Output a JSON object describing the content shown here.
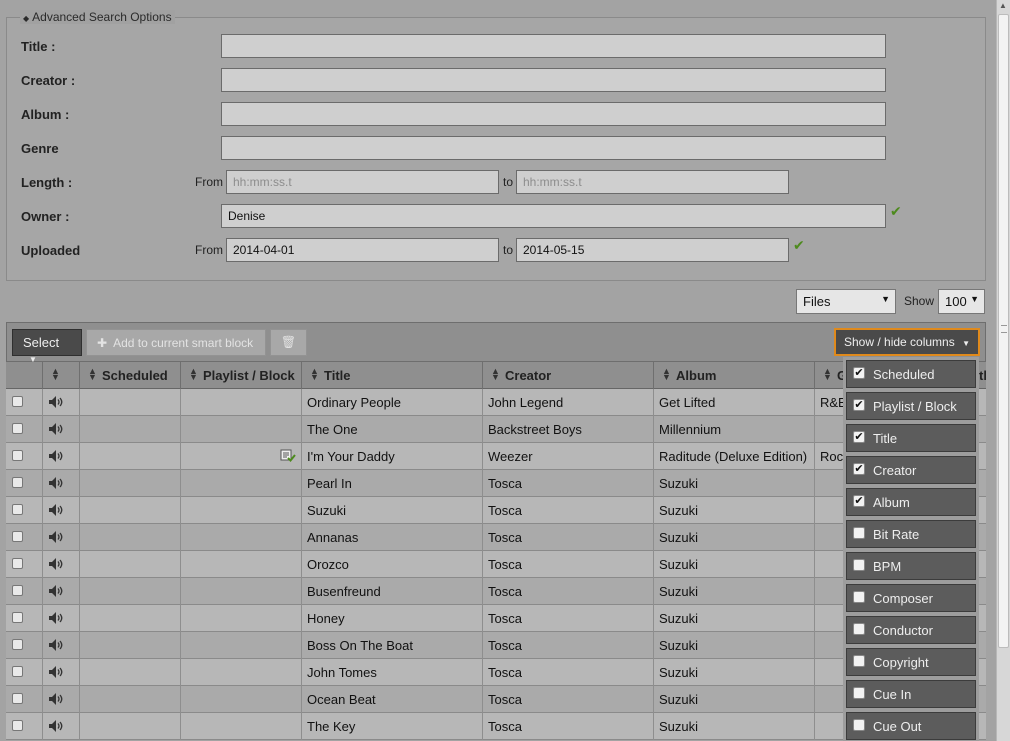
{
  "advanced_search": {
    "legend": "Advanced Search Options",
    "title_label": "Title :",
    "creator_label": "Creator :",
    "album_label": "Album :",
    "genre_label": "Genre",
    "length_label": "Length :",
    "owner_label": "Owner :",
    "uploaded_label": "Uploaded",
    "from_label": "From",
    "to_label": "to",
    "length_from_placeholder": "hh:mm:ss.t",
    "length_to_placeholder": "hh:mm:ss.t",
    "owner_value": "Denise",
    "uploaded_from": "2014-04-01",
    "uploaded_to": "2014-05-15"
  },
  "filter": {
    "type_value": "Files",
    "show_label": "Show",
    "show_value": "100"
  },
  "toolbar": {
    "select_label": "Select",
    "add_label": "Add to current smart block",
    "show_hide_label": "Show / hide columns"
  },
  "columns": [
    "Scheduled",
    "Playlist / Block",
    "Title",
    "Creator",
    "Album",
    "G",
    "th"
  ],
  "rows": [
    {
      "title": "Ordinary People",
      "creator": "John Legend",
      "album": "Get Lifted",
      "genre": "R&B"
    },
    {
      "title": "The One",
      "creator": "Backstreet Boys",
      "album": "Millennium",
      "genre": ""
    },
    {
      "title": "I'm Your Daddy",
      "creator": "Weezer",
      "album": "Raditude (Deluxe Edition)",
      "genre": "Roc"
    },
    {
      "title": "Pearl In",
      "creator": "Tosca",
      "album": "Suzuki",
      "genre": ""
    },
    {
      "title": "Suzuki",
      "creator": "Tosca",
      "album": "Suzuki",
      "genre": ""
    },
    {
      "title": "Annanas",
      "creator": "Tosca",
      "album": "Suzuki",
      "genre": ""
    },
    {
      "title": "Orozco",
      "creator": "Tosca",
      "album": "Suzuki",
      "genre": ""
    },
    {
      "title": "Busenfreund",
      "creator": "Tosca",
      "album": "Suzuki",
      "genre": ""
    },
    {
      "title": "Honey",
      "creator": "Tosca",
      "album": "Suzuki",
      "genre": ""
    },
    {
      "title": "Boss On The Boat",
      "creator": "Tosca",
      "album": "Suzuki",
      "genre": ""
    },
    {
      "title": "John Tomes",
      "creator": "Tosca",
      "album": "Suzuki",
      "genre": ""
    },
    {
      "title": "Ocean Beat",
      "creator": "Tosca",
      "album": "Suzuki",
      "genre": ""
    },
    {
      "title": "The Key",
      "creator": "Tosca",
      "album": "Suzuki",
      "genre": ""
    }
  ],
  "column_menu": [
    {
      "label": "Scheduled",
      "checked": true
    },
    {
      "label": "Playlist / Block",
      "checked": true
    },
    {
      "label": "Title",
      "checked": true
    },
    {
      "label": "Creator",
      "checked": true
    },
    {
      "label": "Album",
      "checked": true
    },
    {
      "label": "Bit Rate",
      "checked": false
    },
    {
      "label": "BPM",
      "checked": false
    },
    {
      "label": "Composer",
      "checked": false
    },
    {
      "label": "Conductor",
      "checked": false
    },
    {
      "label": "Copyright",
      "checked": false
    },
    {
      "label": "Cue In",
      "checked": false
    },
    {
      "label": "Cue Out",
      "checked": false
    }
  ],
  "colors": {
    "accent": "#e08a1c",
    "check": "#4d8a1d"
  }
}
